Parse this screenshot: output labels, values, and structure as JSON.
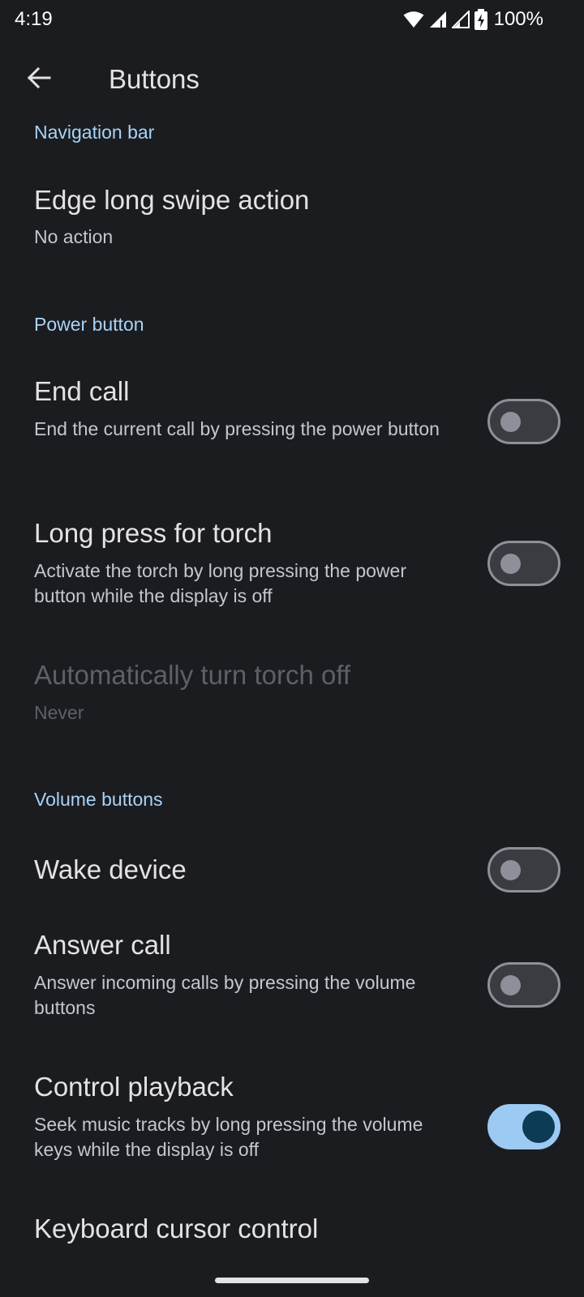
{
  "status_bar": {
    "time": "4:19",
    "battery": "100%",
    "icons": [
      "wifi-icon",
      "signal-icon",
      "signal-icon",
      "battery-charging-icon"
    ]
  },
  "app_bar": {
    "title": "Buttons",
    "back_icon": "arrow-back-icon"
  },
  "sections": {
    "navigation_bar": {
      "header": "Navigation bar",
      "edge_swipe": {
        "title": "Edge long swipe action",
        "summary": "No action"
      }
    },
    "power_button": {
      "header": "Power button",
      "end_call": {
        "title": "End call",
        "summary": "End the current call by pressing the power button",
        "enabled": false
      },
      "torch": {
        "title": "Long press for torch",
        "summary": "Activate the torch by long pressing the power button while the display is off",
        "enabled": false
      },
      "auto_torch_off": {
        "title": "Automatically turn torch off",
        "summary": "Never",
        "disabled": true
      }
    },
    "volume_buttons": {
      "header": "Volume buttons",
      "wake_device": {
        "title": "Wake device",
        "enabled": false
      },
      "answer_call": {
        "title": "Answer call",
        "summary": "Answer incoming calls by pressing the volume buttons",
        "enabled": false
      },
      "control_playback": {
        "title": "Control playback",
        "summary": "Seek music tracks by long pressing the volume keys while the display is off",
        "enabled": true
      },
      "keyboard_cursor": {
        "title": "Keyboard cursor control"
      }
    }
  },
  "colors": {
    "background": "#1b1c20",
    "accent": "#a8d3f7",
    "switch_on_track": "#9ccaf2",
    "switch_on_thumb": "#0c3b55"
  }
}
